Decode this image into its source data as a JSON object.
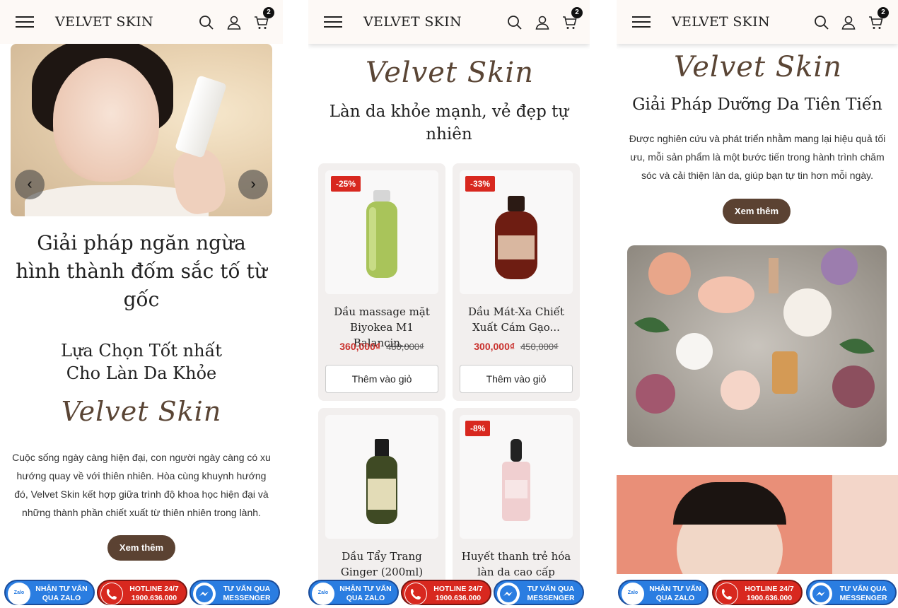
{
  "header": {
    "brand": "VELVET SKIN",
    "cart_count": "2"
  },
  "panel1": {
    "hero_title": "Giải pháp ngăn ngừa hình thành đốm sắc tố từ gốc",
    "section_title_line1": "Lựa Chọn Tốt nhất",
    "section_title_line2": "Cho Làn Da Khỏe",
    "script_logo": "Velvet Skin",
    "description": "Cuộc sống ngày càng hiện đại, con người ngày càng có xu hướng quay về với thiên nhiên. Hòa cùng khuynh hướng đó, Velvet Skin kết hợp giữa trình độ khoa học hiện đại và những thành phần chiết xuất từ thiên nhiên trong lành.",
    "button": "Xem thêm",
    "prev_arrow": "‹",
    "next_arrow": "›"
  },
  "panel2": {
    "script_logo": "Velvet Skin",
    "title": "Làn da khỏe mạnh, vẻ đẹp tự nhiên",
    "products": [
      {
        "discount": "-25%",
        "name": "Dầu massage mặt Biyokea M1 Balancin...",
        "price": "360,000₫",
        "old_price": "480,000₫",
        "button": "Thêm vào giỏ"
      },
      {
        "discount": "-33%",
        "name": "Dầu Mát-Xa Chiết Xuất Cám Gạo...",
        "price": "300,000₫",
        "old_price": "450,000₫",
        "button": "Thêm vào giỏ"
      },
      {
        "discount": "",
        "name": "Dầu Tẩy Trang Ginger (200ml)"
      },
      {
        "discount": "-8%",
        "name": "Huyết thanh trẻ hóa làn da cao cấp Snody..."
      }
    ]
  },
  "panel3": {
    "script_logo": "Velvet Skin",
    "title": "Giải Pháp Dưỡng Da Tiên Tiến",
    "description": "Được nghiên cứu và phát triển nhằm mang lại hiệu quả tối ưu, mỗi sản phẩm là một bước tiến trong hành trình chăm sóc và cải thiện làn da, giúp bạn tự tin hơn mỗi ngày.",
    "button": "Xem thêm"
  },
  "bottom_bar": {
    "zalo_line1": "NHẬN TƯ VẤN",
    "zalo_line2": "QUA ZALO",
    "zalo_icon": "Zalo",
    "hotline_line1": "HOTLINE 24/7",
    "hotline_line2": "1900.636.000",
    "messenger_line1": "TƯ VẤN QUA",
    "messenger_line2": "MESSENGER"
  },
  "colors": {
    "accent_brown": "#5b4232",
    "sale_red": "#c9302c",
    "zalo_blue": "#2a7de1",
    "hotline_red": "#d8281f"
  },
  "icons": [
    "menu-icon",
    "search-icon",
    "user-icon",
    "cart-icon",
    "phone-icon",
    "messenger-icon"
  ]
}
